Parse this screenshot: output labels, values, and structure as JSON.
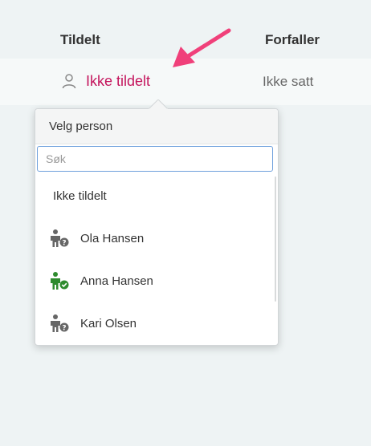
{
  "header": {
    "assigned_label": "Tildelt",
    "due_label": "Forfaller"
  },
  "row": {
    "assign_label": "Ikke tildelt",
    "due_value": "Ikke satt"
  },
  "popup": {
    "title": "Velg person",
    "search": {
      "value": "",
      "placeholder": "Søk"
    },
    "options": [
      {
        "label": "Ikke tildelt",
        "icon": "none"
      },
      {
        "label": "Ola Hansen",
        "icon": "person-unknown-icon"
      },
      {
        "label": "Anna Hansen",
        "icon": "person-verified-icon"
      },
      {
        "label": "Kari Olsen",
        "icon": "person-unknown-icon"
      }
    ]
  },
  "colors": {
    "accent": "#c4145c",
    "arrow": "#f0407a",
    "verified": "#2e8b2e",
    "unknown": "#666666"
  }
}
